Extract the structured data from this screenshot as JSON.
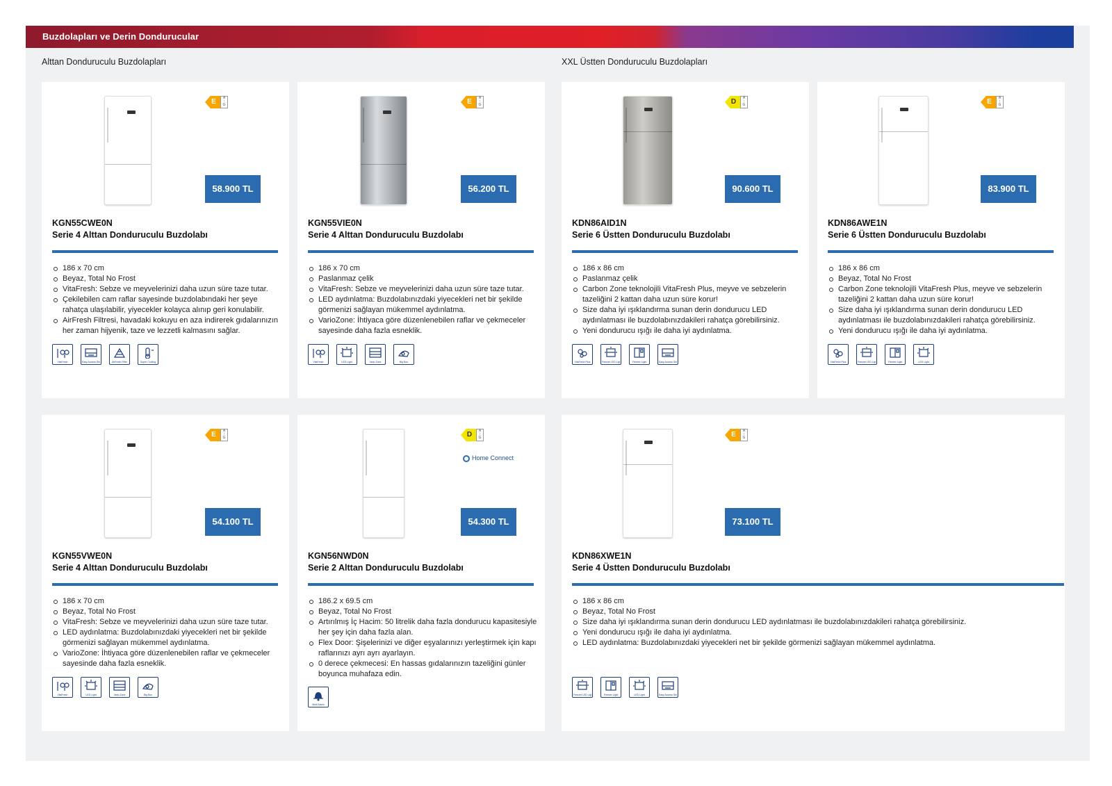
{
  "header": {
    "title": "Buzdolapları ve Derin Dondurucular"
  },
  "sections": {
    "left_title": "Alttan Donduruculu Buzdolapları",
    "right_title": "XXL Üstten Donduruculu Buzdolapları"
  },
  "products": [
    {
      "model": "KGN55CWE0N",
      "name": "Serie 4 Alttan Donduruculu Buzdolabı",
      "price": "58.900 TL",
      "energy_class": "E",
      "energy_scale": [
        "A",
        "↑",
        "G"
      ],
      "color_finish": "white",
      "features": [
        "186 x 70 cm",
        "Beyaz, Total No Frost",
        "VitaFresh: Sebze ve meyvelerinizi daha uzun süre taze tutar.",
        "Çekilebilen cam raflar sayesinde buzdolabındaki her şeye rahatça ulaşılabilir, yiyecekler kolayca alınıp geri konulabilir.",
        "AirFresh Filtresi, havadaki kokuyu en aza indirerek gıdalarınızın her zaman hijyenik, taze ve lezzetli kalmasını sağlar."
      ],
      "icons": [
        {
          "name": "vitafresh-icon",
          "label": "VitaFresh"
        },
        {
          "name": "easy-access-shelf-icon",
          "label": "Easy Access Shelf"
        },
        {
          "name": "airfresh-filter-icon",
          "label": "AirFresh Filter"
        },
        {
          "name": "super-cooling-icon",
          "label": "Super Cooling"
        }
      ]
    },
    {
      "model": "KGN55VIE0N",
      "name": "Serie 4 Alttan Donduruculu Buzdolabı",
      "price": "56.200 TL",
      "energy_class": "E",
      "energy_scale": [
        "A",
        "↑",
        "G"
      ],
      "color_finish": "inox",
      "features": [
        "186 x 70 cm",
        "Paslanmaz çelik",
        "VitaFresh: Sebze ve meyvelerinizi daha uzun süre taze tutar.",
        "LED aydınlatma: Buzdolabınızdaki yiyecekleri net bir şekilde görmenizi sağlayan mükemmel aydınlatma.",
        "VarioZone: İhtiyaca göre düzenlenebilen raflar ve çekmeceler sayesinde daha fazla esneklik."
      ],
      "icons": [
        {
          "name": "vitafresh-icon",
          "label": "VitaFresh"
        },
        {
          "name": "led-light-icon",
          "label": "LED Light"
        },
        {
          "name": "vario-zone-icon",
          "label": "Vario Zone"
        },
        {
          "name": "big-box-icon",
          "label": "Big Box"
        }
      ]
    },
    {
      "model": "KDN86AID1N",
      "name": "Serie 6 Üstten Donduruculu Buzdolabı",
      "price": "90.600 TL",
      "energy_class": "D",
      "energy_scale": [
        "A",
        "↑",
        "G"
      ],
      "color_finish": "inox-look",
      "features": [
        "186 x 86 cm",
        "Paslanmaz çelik",
        "Carbon Zone teknolojili VitaFresh Plus, meyve ve sebzelerin tazeliğini 2 kattan daha uzun süre korur!",
        "Size daha iyi ışıklandırma sunan derin dondurucu LED aydınlatması ile buzdolabınızdakileri rahatça görebilirsiniz.",
        "Yeni dondurucu ışığı ile daha iyi aydınlatma."
      ],
      "icons": [
        {
          "name": "vitafresh-plus-icon",
          "label": "VitaFresh Plus"
        },
        {
          "name": "freezer-led-light-icon",
          "label": "Freezer LED Light"
        },
        {
          "name": "freezer-light-icon",
          "label": "Freezer Light"
        },
        {
          "name": "easy-access-shelf-icon",
          "label": "Easy Access Shelf"
        }
      ]
    },
    {
      "model": "KDN86AWE1N",
      "name": "Serie 6 Üstten Donduruculu Buzdolabı",
      "price": "83.900 TL",
      "energy_class": "E",
      "energy_scale": [
        "A",
        "↑",
        "G"
      ],
      "color_finish": "white",
      "features": [
        "186 x 86 cm",
        "Beyaz, Total No Frost",
        "Carbon Zone teknolojili VitaFresh Plus, meyve ve sebzelerin tazeliğini 2 kattan daha uzun süre korur!",
        "Size daha iyi ışıklandırma sunan derin dondurucu LED aydınlatması ile buzdolabınızdakileri rahatça görebilirsiniz.",
        "Yeni dondurucu ışığı ile daha iyi aydınlatma."
      ],
      "icons": [
        {
          "name": "vitafresh-plus-icon",
          "label": "VitaFresh Plus"
        },
        {
          "name": "freezer-led-light-icon",
          "label": "Freezer LED Light"
        },
        {
          "name": "freezer-light-icon",
          "label": "Freezer Light"
        },
        {
          "name": "led-light-icon",
          "label": "LED Light"
        }
      ]
    },
    {
      "model": "KGN55VWE0N",
      "name": "Serie 4 Alttan Donduruculu Buzdolabı",
      "price": "54.100 TL",
      "energy_class": "E",
      "energy_scale": [
        "A",
        "↑",
        "G"
      ],
      "color_finish": "white",
      "features": [
        "186 x 70 cm",
        "Beyaz, Total No Frost",
        "VitaFresh: Sebze ve meyvelerinizi daha uzun süre taze tutar.",
        "LED aydınlatma: Buzdolabınızdaki yiyecekleri net bir şekilde görmenizi sağlayan mükemmel aydınlatma.",
        "VarioZone: İhtiyaca göre düzenlenebilen raflar ve çekmeceler sayesinde daha fazla esneklik."
      ],
      "icons": [
        {
          "name": "vitafresh-icon",
          "label": "VitaFresh"
        },
        {
          "name": "led-light-icon",
          "label": "LED Light"
        },
        {
          "name": "vario-zone-icon",
          "label": "Vario Zone"
        },
        {
          "name": "big-box-icon",
          "label": "Big Box"
        }
      ]
    },
    {
      "model": "KGN56NWD0N",
      "name": "Serie 2 Alttan Donduruculu Buzdolabı",
      "price": "54.300 TL",
      "energy_class": "D",
      "energy_scale": [
        "A",
        "↑",
        "G"
      ],
      "color_finish": "white",
      "home_connect": "Home Connect",
      "features": [
        "186.2 x 69.5 cm",
        "Beyaz, Total No Frost",
        "Artırılmış İç Hacim: 50 litrelik daha fazla dondurucu kapasitesiyle her şey için daha fazla alan.",
        "Flex Door: Şişelerinizi ve diğer eşyalarınızı yerleştirmek için kapı raflarınızı ayrı ayrı ayarlayın.",
        "0 derece çekmecesi: En hassas gıdalarınızın tazeliğini günler boyunca muhafaza edin."
      ],
      "icons": [
        {
          "name": "multi-alarm-icon",
          "label": "Multi Alarm"
        }
      ]
    },
    {
      "model": "KDN86XWE1N",
      "name": "Serie 4 Üstten Donduruculu Buzdolabı",
      "price": "73.100 TL",
      "energy_class": "E",
      "energy_scale": [
        "A",
        "↑",
        "G"
      ],
      "color_finish": "white",
      "features": [
        "186 x 86 cm",
        "Beyaz, Total No Frost",
        "Size daha iyi ışıklandırma sunan derin dondurucu LED aydınlatması ile buzdolabınızdakileri rahatça görebilirsiniz.",
        "Yeni dondurucu ışığı ile daha iyi aydınlatma.",
        "LED aydınlatma: Buzdolabınızdaki yiyecekleri net bir şekilde görmenizi sağlayan mükemmel aydınlatma."
      ],
      "icons": [
        {
          "name": "freezer-led-light-icon",
          "label": "Freezer LED Light"
        },
        {
          "name": "freezer-light-icon",
          "label": "Freezer Light"
        },
        {
          "name": "led-light-icon",
          "label": "LED Light"
        },
        {
          "name": "easy-access-shelf-icon",
          "label": "Easy Access Shelf"
        }
      ]
    }
  ],
  "colors": {
    "price_badge": "#2b6cb0",
    "rule": "#2b6cb0",
    "energy_E": "#f7a600",
    "energy_D": "#f2e500",
    "icon_stroke": "#1d3e7a"
  }
}
